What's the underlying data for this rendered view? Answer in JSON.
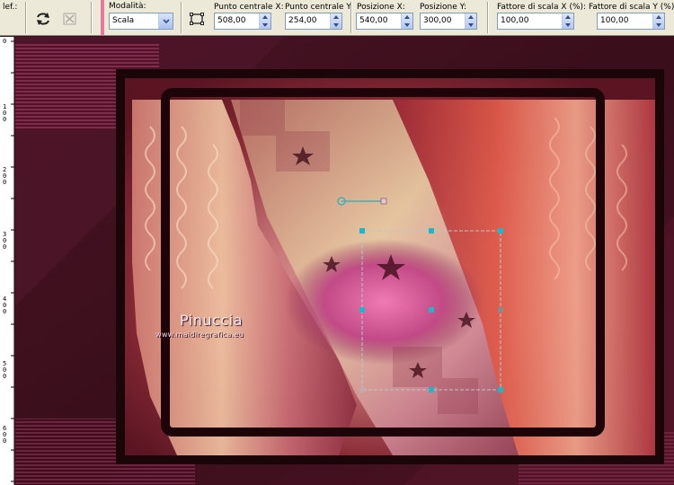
{
  "toolbar": {
    "preset_label": "lef.:",
    "mode": {
      "label": "Modalità:",
      "value": "Scala"
    },
    "center_x": {
      "label": "Punto centrale X:",
      "value": "508,00"
    },
    "center_y": {
      "label": "Punto centrale Y:",
      "value": "254,00"
    },
    "position_x": {
      "label": "Posizione X:",
      "value": "540,00"
    },
    "position_y": {
      "label": "Posizione Y:",
      "value": "300,00"
    },
    "scale_x": {
      "label": "Fattore di scala X (%):",
      "value": "100,00"
    },
    "scale_y": {
      "label": "Fattore di scala Y (%):",
      "value": "100,00"
    }
  },
  "icons": [
    "reset-arrows-icon",
    "clear-icon",
    "edit-mode-icon"
  ],
  "ruler": {
    "marks": [
      "0",
      "1\n0\n0",
      "2\n0\n0",
      "3\n0\n0",
      "4\n0\n0",
      "5\n0\n0",
      "6\n0\n0"
    ]
  },
  "watermark": {
    "name": "Pinuccia",
    "site": "www.maidiregrafica.eu"
  },
  "colors": {
    "accent": "#e9799c",
    "handle": "#1fb6c9",
    "canvas_bg": "#3d1020"
  }
}
